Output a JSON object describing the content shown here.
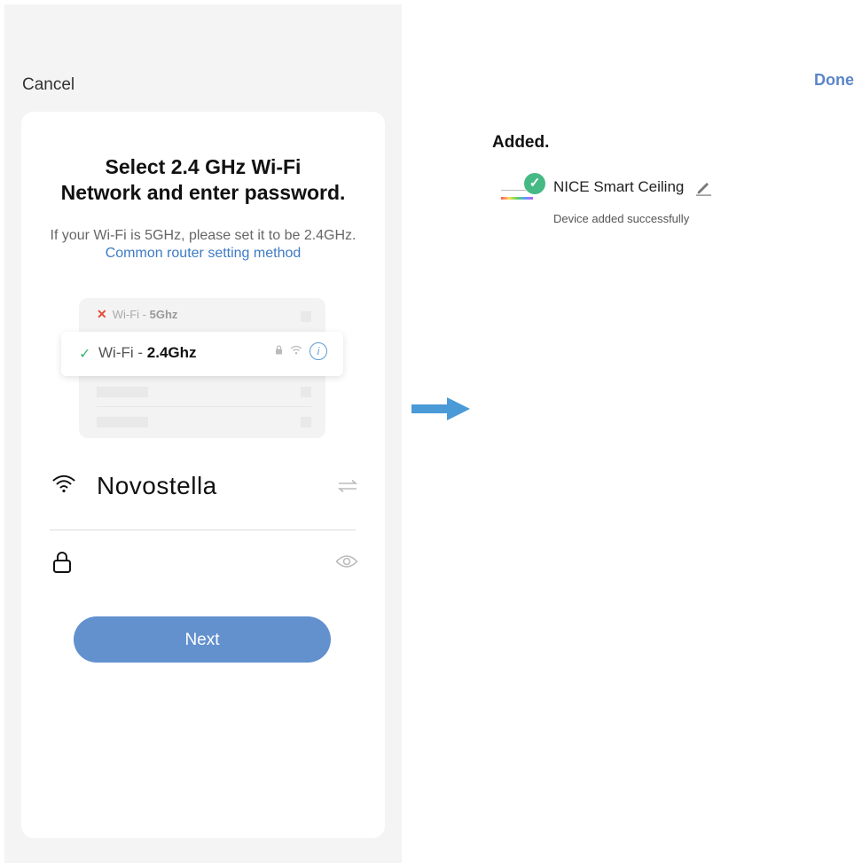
{
  "left": {
    "cancel_label": "Cancel",
    "card": {
      "title_line1": "Select 2.4 GHz Wi-Fi",
      "title_line2": "Network and enter password.",
      "desc_prefix": "If your Wi-Fi is 5GHz, please set it to be 2.4GHz.",
      "desc_link": "Common router setting method",
      "illustration": {
        "row1_prefix": "Wi-Fi - ",
        "row1_band": "5Ghz",
        "row2_prefix": "Wi-Fi - ",
        "row2_band": "2.4Ghz"
      },
      "ssid": "Novostella",
      "next_label": "Next"
    }
  },
  "right": {
    "done_label": "Done",
    "added_heading": "Added.",
    "device": {
      "name": "NICE Smart Ceiling",
      "status": "Device added successfully"
    }
  },
  "colors": {
    "accent": "#6391ce",
    "link": "#3e7bc4",
    "success": "#46b985",
    "done": "#5b86c6",
    "arrow": "#4a9ad8"
  }
}
